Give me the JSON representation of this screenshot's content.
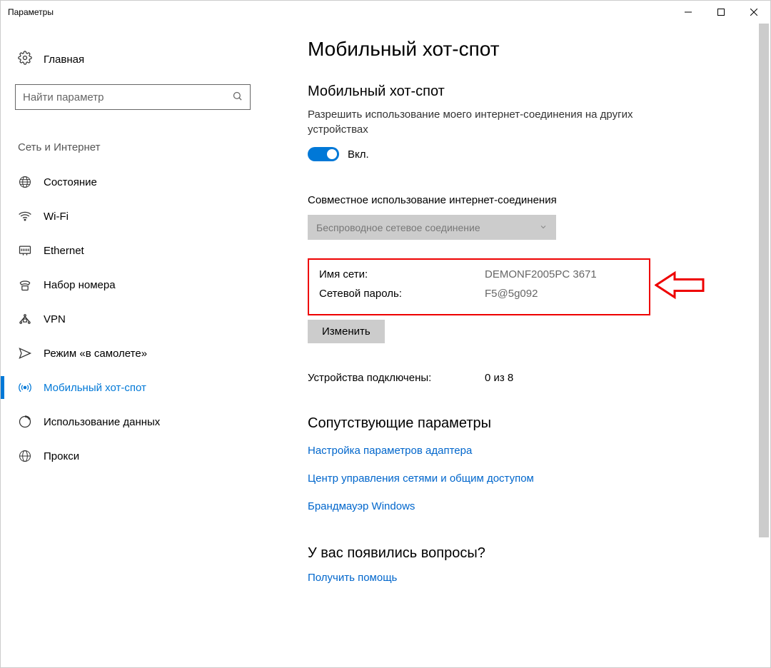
{
  "window": {
    "title": "Параметры"
  },
  "sidebar": {
    "home_label": "Главная",
    "search_placeholder": "Найти параметр",
    "category_label": "Сеть и Интернет",
    "items": [
      {
        "label": "Состояние",
        "icon": "globe-wire"
      },
      {
        "label": "Wi-Fi",
        "icon": "wifi"
      },
      {
        "label": "Ethernet",
        "icon": "ethernet"
      },
      {
        "label": "Набор номера",
        "icon": "dial"
      },
      {
        "label": "VPN",
        "icon": "vpn"
      },
      {
        "label": "Режим «в самолете»",
        "icon": "airplane"
      },
      {
        "label": "Мобильный хот-спот",
        "icon": "hotspot",
        "active": true
      },
      {
        "label": "Использование данных",
        "icon": "data-usage"
      },
      {
        "label": "Прокси",
        "icon": "globe-net"
      }
    ]
  },
  "main": {
    "page_title": "Мобильный хот-спот",
    "hotspot_section": {
      "title": "Мобильный хот-спот",
      "desc": "Разрешить использование моего интернет-соединения на других устройствах",
      "toggle_state": "Вкл."
    },
    "share_label": "Совместное использование интернет-соединения",
    "dropdown_value": "Беспроводное сетевое соединение",
    "network_name_label": "Имя сети:",
    "network_name_value": "DEMONF2005PC 3671",
    "network_pass_label": "Сетевой пароль:",
    "network_pass_value": "F5@5g092",
    "edit_button": "Изменить",
    "devices_label": "Устройства подключены:",
    "devices_value": "0 из 8",
    "related_title": "Сопутствующие параметры",
    "links": [
      "Настройка параметров адаптера",
      "Центр управления сетями и общим доступом",
      "Брандмауэр Windows"
    ],
    "questions_title": "У вас появились вопросы?",
    "questions_link": "Получить помощь"
  }
}
